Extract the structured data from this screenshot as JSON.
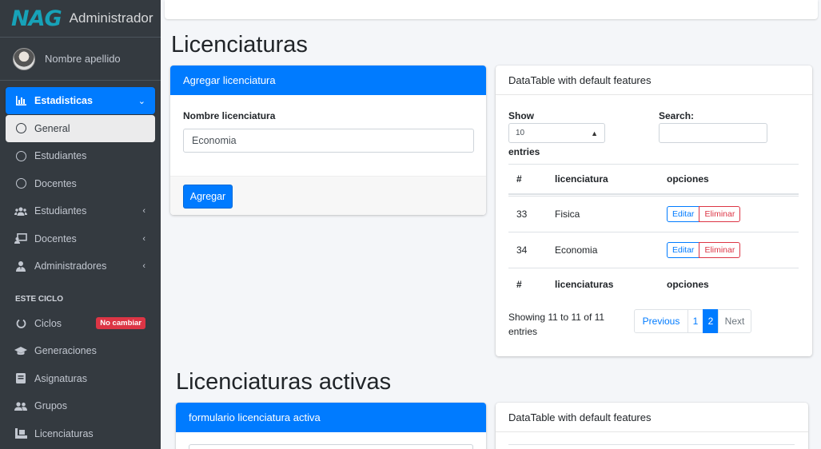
{
  "brand": {
    "logo": "NAG",
    "title": "Administrador"
  },
  "user": {
    "name": "Nombre apellido"
  },
  "sidebar": {
    "items": [
      {
        "label": "Estadisticas",
        "icon": "chart-bar-icon"
      },
      {
        "label": "General",
        "icon": "circle-icon"
      },
      {
        "label": "Estudiantes",
        "icon": "circle-icon"
      },
      {
        "label": "Docentes",
        "icon": "circle-icon"
      },
      {
        "label": "Estudiantes",
        "icon": "users-icon"
      },
      {
        "label": "Docentes",
        "icon": "chalkboard-teacher-icon"
      },
      {
        "label": "Administradores",
        "icon": "user-tie-icon"
      }
    ],
    "section_header": "ESTE CICLO",
    "items2": [
      {
        "label": "Ciclos",
        "icon": "power-icon",
        "badge": "No cambiar"
      },
      {
        "label": "Generaciones",
        "icon": "graduation-cap-icon"
      },
      {
        "label": "Asignaturas",
        "icon": "book-icon"
      },
      {
        "label": "Grupos",
        "icon": "user-group-icon"
      },
      {
        "label": "Licenciaturas",
        "icon": "book-reader-icon"
      }
    ]
  },
  "main": {
    "title": "Licenciaturas",
    "form_card": {
      "header": "Agregar licenciatura",
      "field_label": "Nombre licenciatura",
      "field_value": "Economia",
      "submit_label": "Agregar"
    },
    "table_card": {
      "header": "DataTable with default features",
      "show_label": "Show",
      "length_value": "10",
      "entries_label": "entries",
      "search_label": "Search:",
      "columns": [
        "#",
        "licenciatura",
        "opciones"
      ],
      "rows": [
        {
          "id": "33",
          "name": "Fisica"
        },
        {
          "id": "34",
          "name": "Economia"
        }
      ],
      "footer_columns": [
        "#",
        "licenciaturas",
        "opciones"
      ],
      "edit_label": "Editar",
      "delete_label": "Eliminar",
      "info": "Showing 11 to 11 of 11 entries",
      "pagination": {
        "previous": "Previous",
        "pages": [
          "1",
          "2"
        ],
        "current": "2",
        "next": "Next"
      }
    },
    "title2": "Licenciaturas activas",
    "form_card2": {
      "header": "formulario licenciatura activa"
    },
    "table_card2": {
      "header": "DataTable with default features"
    }
  },
  "colors": {
    "primary": "#007bff",
    "danger": "#dc3545",
    "sidebar": "#343a40"
  }
}
